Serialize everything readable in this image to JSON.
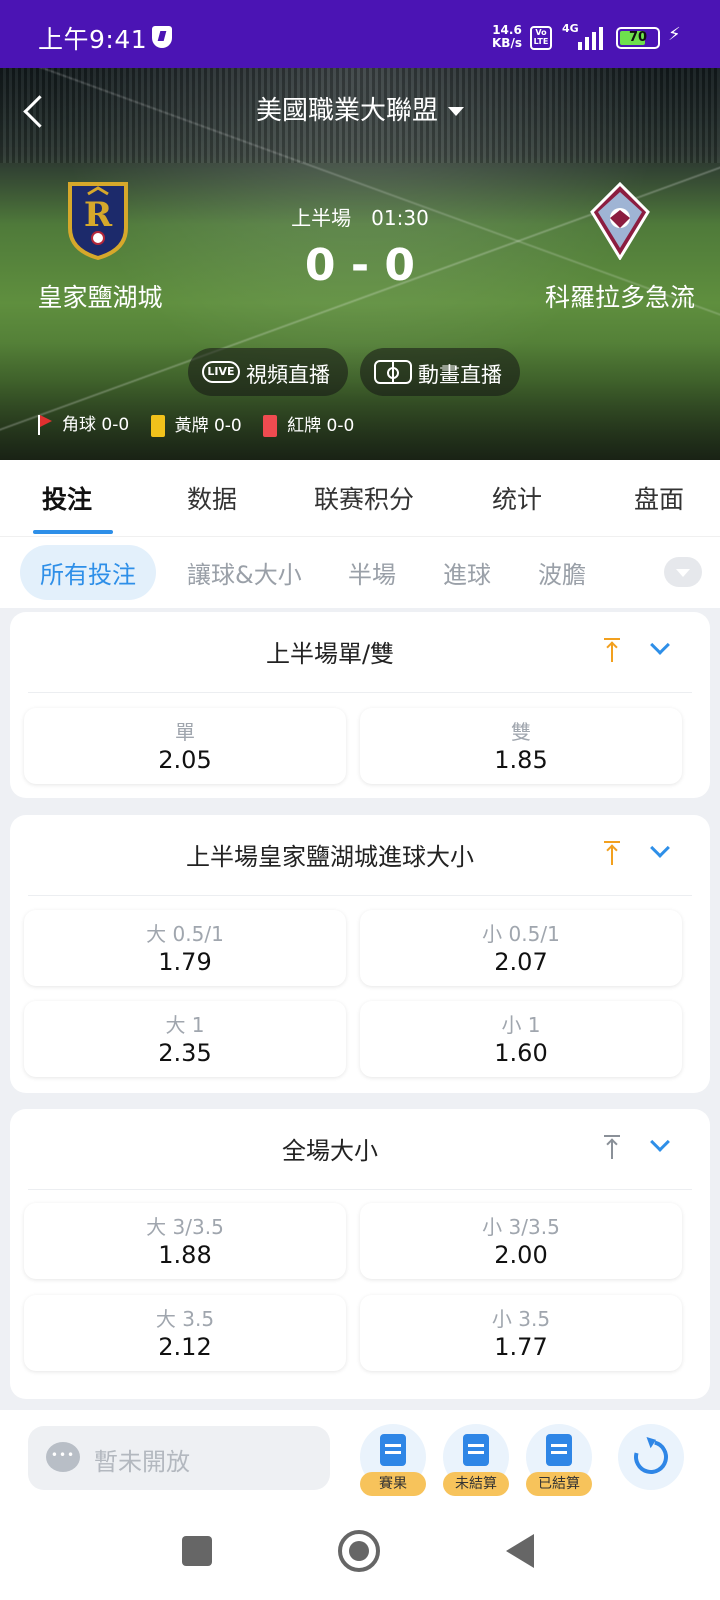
{
  "status_bar": {
    "time": "上午9:41",
    "net_speed_value": "14.6",
    "net_speed_unit": "KB/s",
    "volte": "Vo LTE",
    "network": "4G",
    "battery": "70",
    "battery_level": 0.7
  },
  "header": {
    "league": "美國職業大聯盟"
  },
  "match": {
    "home_team": "皇家鹽湖城",
    "away_team": "科羅拉多急流",
    "period": "上半場",
    "clock": "01:30",
    "score": "0 - 0",
    "live_video_label": "視頻直播",
    "live_icon_text": "LIVE",
    "animation_label": "動畫直播",
    "stats": {
      "corners": "角球 0-0",
      "yellow_cards": "黃牌 0-0",
      "red_cards": "紅牌 0-0"
    }
  },
  "main_tabs": [
    "投注",
    "数据",
    "联赛积分",
    "统计",
    "盘面"
  ],
  "sub_tabs": [
    "所有投注",
    "讓球&大小",
    "半場",
    "進球",
    "波膽"
  ],
  "markets": [
    {
      "title": "上半場單/雙",
      "pinned": true,
      "odds": [
        {
          "label": "單",
          "value": "2.05"
        },
        {
          "label": "雙",
          "value": "1.85"
        }
      ]
    },
    {
      "title": "上半場皇家鹽湖城進球大小",
      "pinned": true,
      "odds": [
        {
          "label": "大 0.5/1",
          "value": "1.79"
        },
        {
          "label": "小 0.5/1",
          "value": "2.07"
        },
        {
          "label": "大 1",
          "value": "2.35"
        },
        {
          "label": "小 1",
          "value": "1.60"
        }
      ]
    },
    {
      "title": "全場大小",
      "pinned": false,
      "odds": [
        {
          "label": "大 3/3.5",
          "value": "1.88"
        },
        {
          "label": "小 3/3.5",
          "value": "2.00"
        },
        {
          "label": "大 3.5",
          "value": "2.12"
        },
        {
          "label": "小 3.5",
          "value": "1.77"
        }
      ]
    }
  ],
  "bottom_bar": {
    "chat_placeholder": "暫未開放",
    "tools": [
      "賽果",
      "未結算",
      "已結算"
    ]
  },
  "colors": {
    "status_bar": "#4b14b4",
    "accent": "#2e8fe8",
    "pin_active": "#f2a01e",
    "yellow_card": "#f1c21b",
    "red_card": "#ef4b50"
  }
}
